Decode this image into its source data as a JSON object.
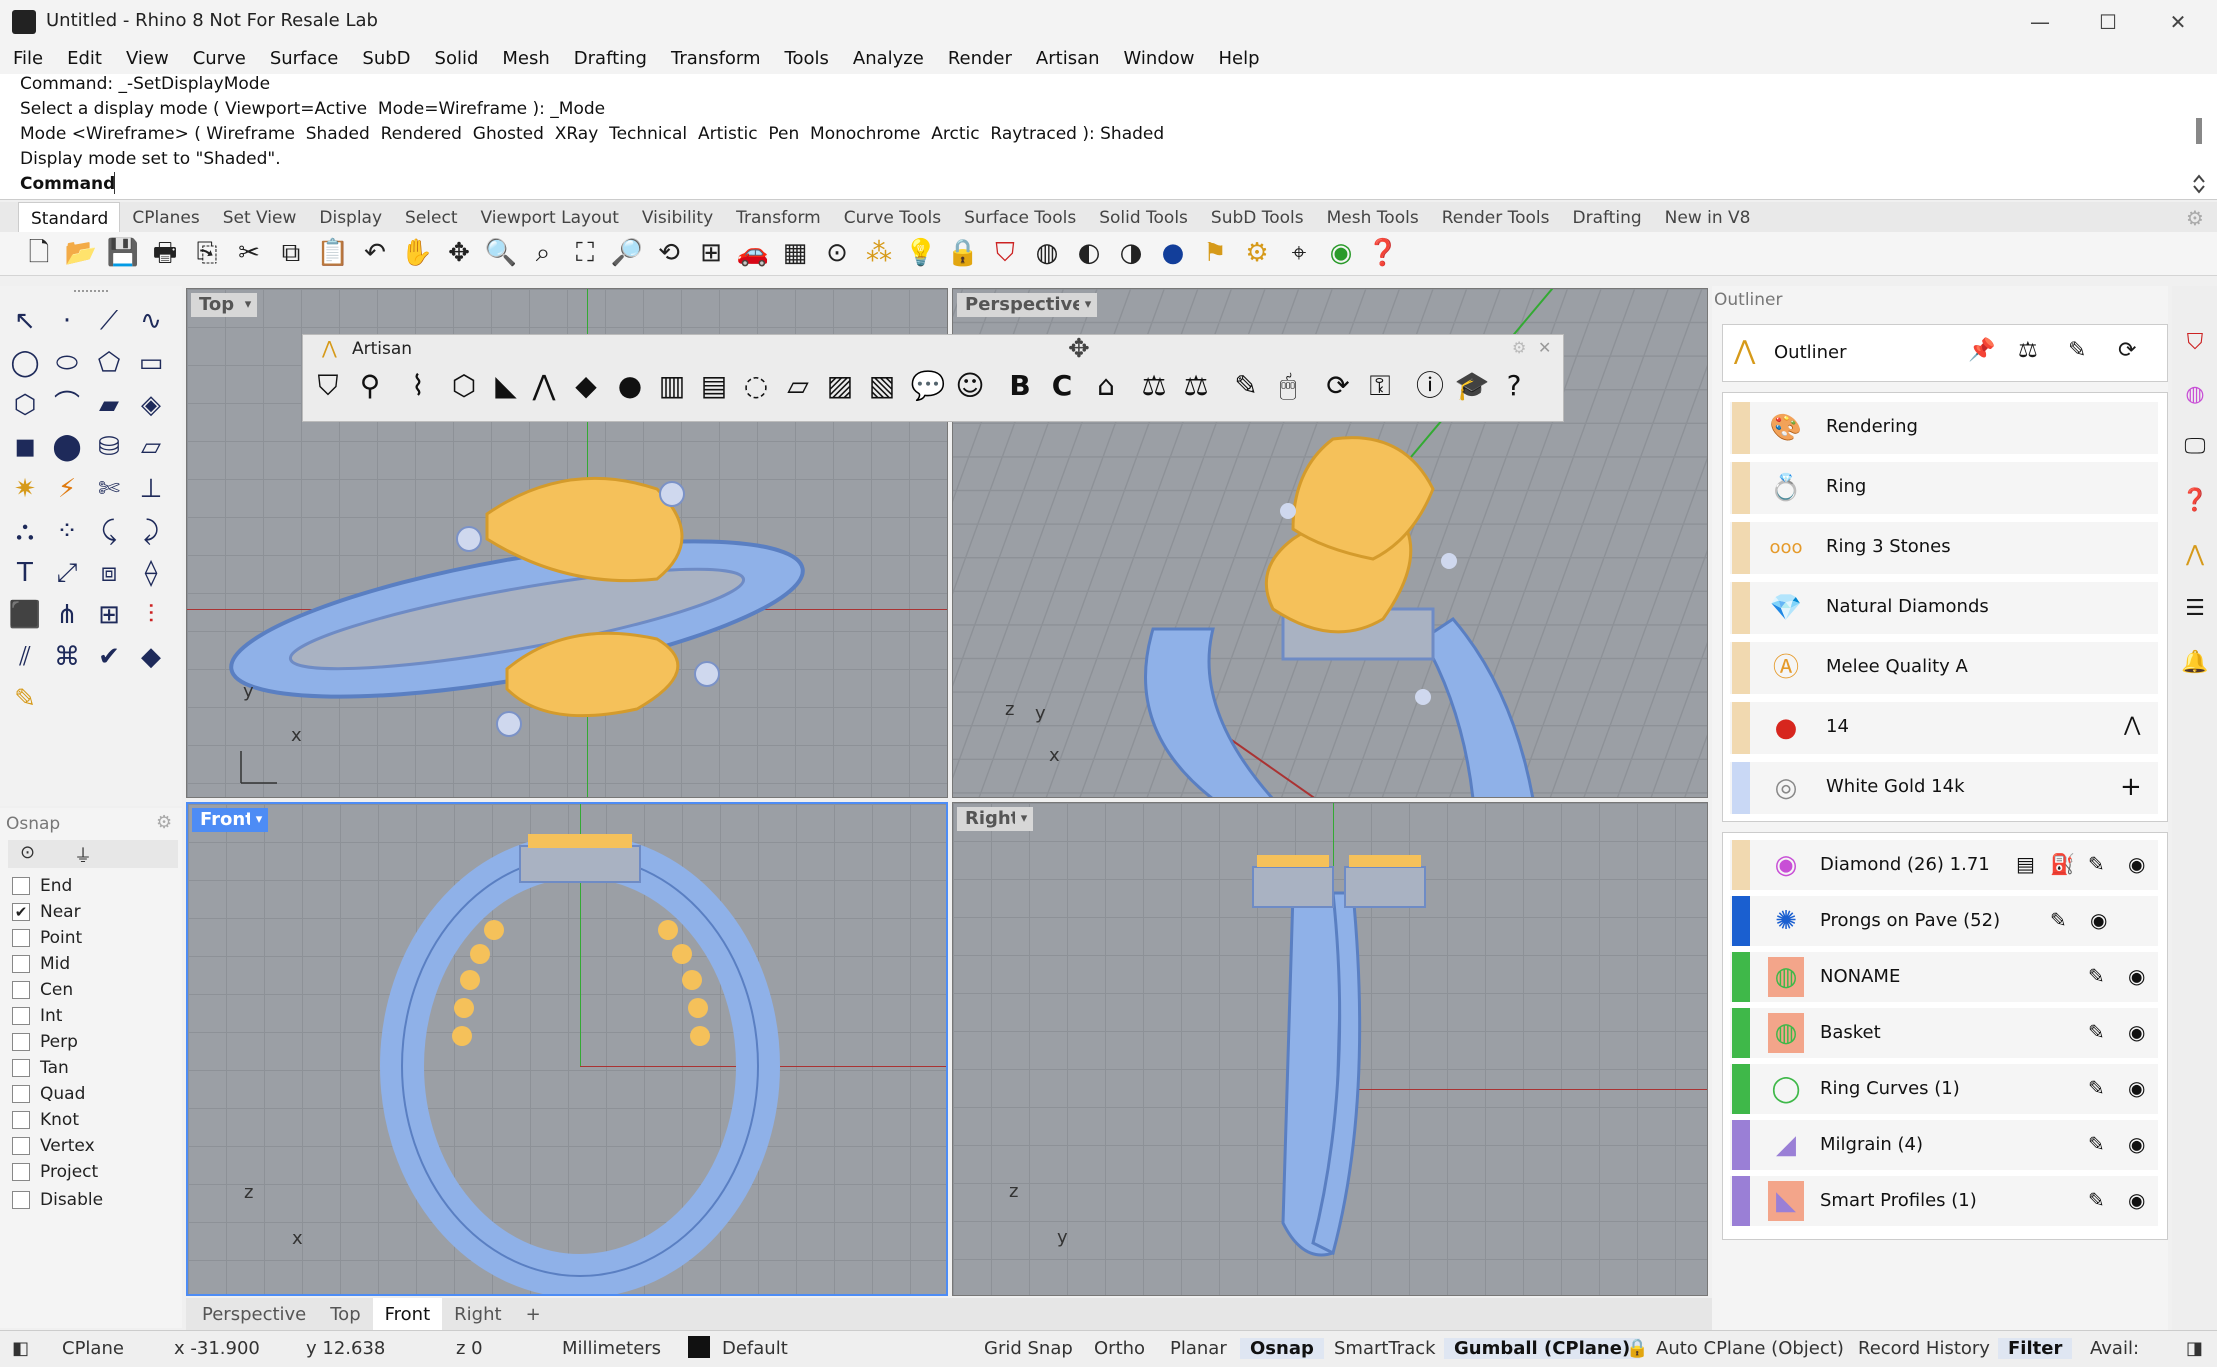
{
  "window": {
    "title": "Untitled - Rhino 8 Not For Resale Lab",
    "minimize": "—",
    "maximize": "☐",
    "close": "✕"
  },
  "menu": [
    "File",
    "Edit",
    "View",
    "Curve",
    "Surface",
    "SubD",
    "Solid",
    "Mesh",
    "Drafting",
    "Transform",
    "Tools",
    "Analyze",
    "Render",
    "Artisan",
    "Window",
    "Help"
  ],
  "command_history": [
    "Command: _-SetDisplayMode",
    "Select a display mode ( Viewport=Active  Mode=Wireframe ): _Mode",
    "Mode <Wireframe> ( Wireframe  Shaded  Rendered  Ghosted  XRay  Technical  Artistic  Pen  Monochrome  Arctic  Raytraced ): Shaded",
    "Display mode set to \"Shaded\"."
  ],
  "command_prompt": "Command:",
  "toolbar_tabs": [
    "Standard",
    "CPlanes",
    "Set View",
    "Display",
    "Select",
    "Viewport Layout",
    "Visibility",
    "Transform",
    "Curve Tools",
    "Surface Tools",
    "Solid Tools",
    "SubD Tools",
    "Mesh Tools",
    "Render Tools",
    "Drafting",
    "New in V8"
  ],
  "active_tab": "Standard",
  "viewports": {
    "top": {
      "label": "Top",
      "arrow": "▾",
      "axis_x": "x",
      "axis_y": "y"
    },
    "perspective": {
      "label": "Perspective",
      "arrow": "▾",
      "axis_x": "x",
      "axis_y": "y",
      "axis_z": "z"
    },
    "front": {
      "label": "Front",
      "arrow": "▾",
      "axis_x": "x",
      "axis_z": "z"
    },
    "right": {
      "label": "Right",
      "arrow": "▾",
      "axis_y": "y",
      "axis_z": "z"
    }
  },
  "artisan_toolbar": {
    "title": "Artisan"
  },
  "osnap": {
    "title": "Osnap",
    "items": [
      {
        "label": "End",
        "checked": false
      },
      {
        "label": "Near",
        "checked": true
      },
      {
        "label": "Point",
        "checked": false
      },
      {
        "label": "Mid",
        "checked": false
      },
      {
        "label": "Cen",
        "checked": false
      },
      {
        "label": "Int",
        "checked": false
      },
      {
        "label": "Perp",
        "checked": false
      },
      {
        "label": "Tan",
        "checked": false
      },
      {
        "label": "Quad",
        "checked": false
      },
      {
        "label": "Knot",
        "checked": false
      },
      {
        "label": "Vertex",
        "checked": false
      },
      {
        "label": "Project",
        "checked": false
      },
      {
        "label": "Disable",
        "checked": false
      }
    ]
  },
  "viewport_tabs": [
    "Perspective",
    "Top",
    "Front",
    "Right"
  ],
  "active_viewport_tab": "Front",
  "viewport_tab_add": "+",
  "outliner": {
    "panel_title": "Outliner",
    "header_title": "Outliner",
    "settings_items": [
      {
        "label": "Rendering",
        "bar": "#f1d9b0",
        "icon": "🎨"
      },
      {
        "label": "Ring",
        "bar": "#f1d9b0",
        "icon": "💍"
      },
      {
        "label": "Ring 3 Stones",
        "bar": "#f1d9b0",
        "icon": "ooo"
      },
      {
        "label": "Natural Diamonds",
        "bar": "#f1d9b0",
        "icon": "💎"
      },
      {
        "label": "Melee Quality A",
        "bar": "#f1d9b0",
        "icon": "Ⓐ"
      },
      {
        "label": "14",
        "bar": "#f1d9b0",
        "icon": "●"
      },
      {
        "label": "White Gold 14k",
        "bar": "#c9d8f5",
        "icon": "◎"
      }
    ],
    "layers": [
      {
        "label": "Diamond (26) 1.71",
        "bar": "#f1d9b0",
        "icon": "◉"
      },
      {
        "label": "Prongs on Pave (52)",
        "bar": "#1a5fd0",
        "icon": "✺"
      },
      {
        "label": "NONAME",
        "bar": "#3fb849",
        "icon": "◍"
      },
      {
        "label": "Basket",
        "bar": "#3fb849",
        "icon": "◍"
      },
      {
        "label": "Ring Curves (1)",
        "bar": "#3fb849",
        "icon": "◯"
      },
      {
        "label": "Milgrain (4)",
        "bar": "#9a7fd6",
        "icon": "◢"
      },
      {
        "label": "Smart Profiles (1)",
        "bar": "#9a7fd6",
        "icon": "◣"
      }
    ]
  },
  "status": {
    "cplane": "CPlane",
    "x": "x -31.900",
    "y": "y 12.638",
    "z": "z 0",
    "units": "Millimeters",
    "layer": "Default",
    "grid_snap": "Grid Snap",
    "ortho": "Ortho",
    "planar": "Planar",
    "osnap": "Osnap",
    "smarttrack": "SmartTrack",
    "gumball": "Gumball (CPlane)",
    "auto_cplane": "Auto CPlane (Object)",
    "record_history": "Record History",
    "filter": "Filter",
    "avail": "Avail:"
  },
  "colors": {
    "accent": "#4d8cf5",
    "viewport_bg": "#9b9fa5",
    "gem": "#f5c15a",
    "metal": "#8fb1e8"
  }
}
